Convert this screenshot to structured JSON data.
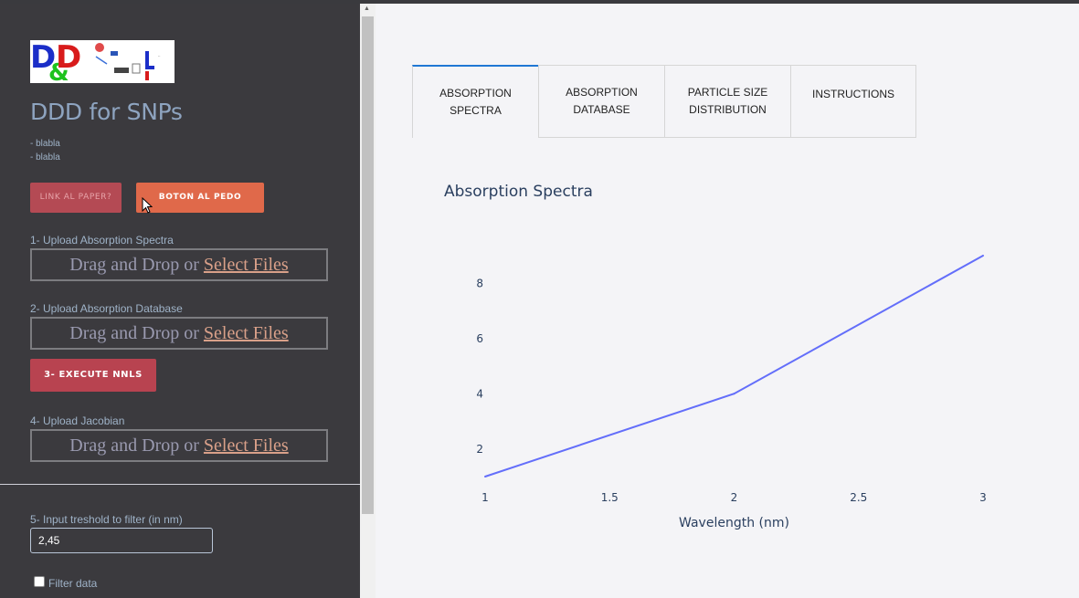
{
  "sidebar": {
    "title": "DDD for SNPs",
    "notes": [
      "- blabla",
      "- blabla"
    ],
    "link_button": "LINK AL PAPER?",
    "boton_button": "BOTON AL PEDO",
    "upload_spectra_label": "1- Upload Absorption Spectra",
    "upload_database_label": "2- Upload Absorption Database",
    "execute_button": "3- EXECUTE NNLS",
    "upload_jacobian_label": "4- Upload Jacobian",
    "dropzone_text": "Drag and Drop or ",
    "dropzone_link": "Select Files",
    "threshold_label": "5- Input treshold to filter (in nm)",
    "threshold_value": "2,45",
    "filter_label": "Filter data",
    "filter_checked": false
  },
  "tabs": [
    {
      "label": "ABSORPTION SPECTRA",
      "active": true
    },
    {
      "label": "ABSORPTION DATABASE",
      "active": false
    },
    {
      "label": "PARTICLE SIZE DISTRIBUTION",
      "active": false
    },
    {
      "label": "INSTRUCTIONS",
      "active": false
    }
  ],
  "chart_data": {
    "type": "line",
    "title": "Absorption Spectra",
    "xlabel": "Wavelength (nm)",
    "ylabel": "",
    "x": [
      1,
      2,
      3
    ],
    "y": [
      1,
      4,
      9
    ],
    "xlim": [
      1,
      3
    ],
    "ylim": [
      1,
      9
    ],
    "xticks": [
      1,
      1.5,
      2,
      2.5,
      3
    ],
    "yticks": [
      2,
      4,
      6,
      8
    ],
    "grid": false,
    "line_color": "#636efa"
  },
  "colors": {
    "sidebar_bg": "#3b3a3e",
    "accent_orange": "#e0694a",
    "accent_red": "#b84350",
    "tab_active": "#1f77d4"
  }
}
